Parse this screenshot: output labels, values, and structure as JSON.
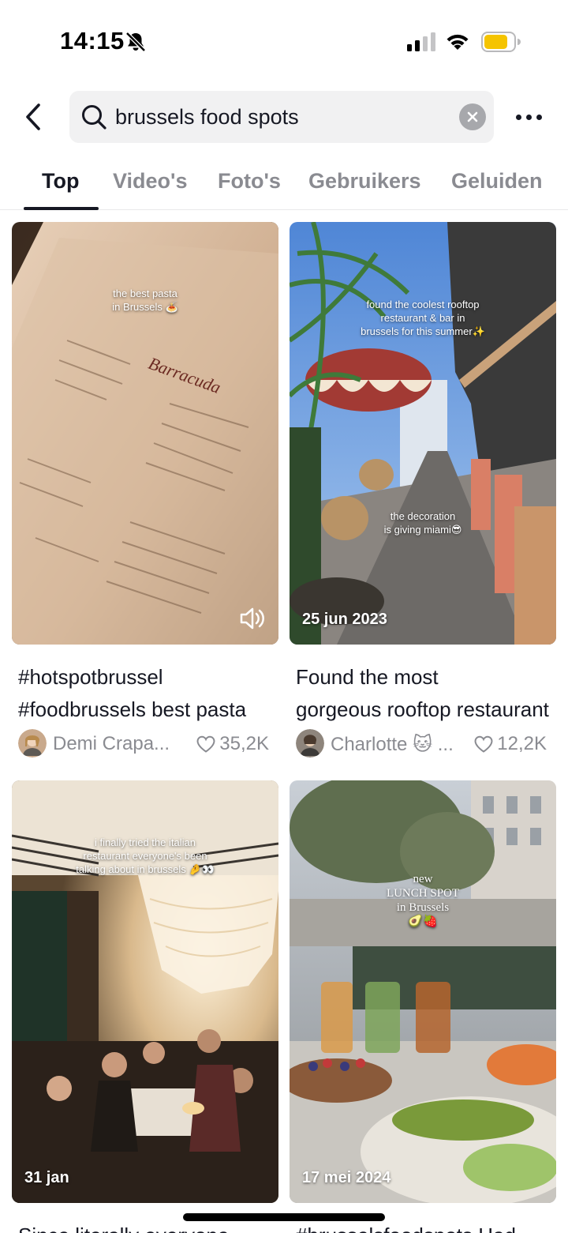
{
  "status_bar": {
    "time": "14:15"
  },
  "search": {
    "query": "brussels food spots"
  },
  "tabs": [
    {
      "label": "Top"
    },
    {
      "label": "Video's"
    },
    {
      "label": "Foto's"
    },
    {
      "label": "Gebruikers"
    },
    {
      "label": "Geluiden"
    }
  ],
  "results": [
    {
      "overlay": "the best pasta\nin Brussels 🍝",
      "overlay2": "",
      "date": "",
      "caption_line1": "#hotspotbrussel",
      "caption_line2": "#foodbrussels best pasta",
      "username": "Demi Crapa...",
      "likes": "35,2K"
    },
    {
      "overlay": "found the coolest rooftop\nrestaurant & bar in\nbrussels for this summer✨",
      "overlay2": "the decoration\nis giving miami😎",
      "date": "25 jun 2023",
      "caption_line1": "Found the most",
      "caption_line2": "gorgeous rooftop restaurant",
      "username": "Charlotte 🐱 ...",
      "likes": "12,2K"
    },
    {
      "overlay": "i finally tried the italian\nrestaurant everyone's been\ntalking about in brussels 🤌👀",
      "overlay2": "",
      "date": "31 jan",
      "caption_line1": "Since literally everyone"
    },
    {
      "overlay": "new\nLUNCH SPOT\nin Brussels\n🥑🍓",
      "overlay2": "",
      "date": "17 mei 2024",
      "caption_line1": "#brusselsfoodspots Had"
    }
  ]
}
